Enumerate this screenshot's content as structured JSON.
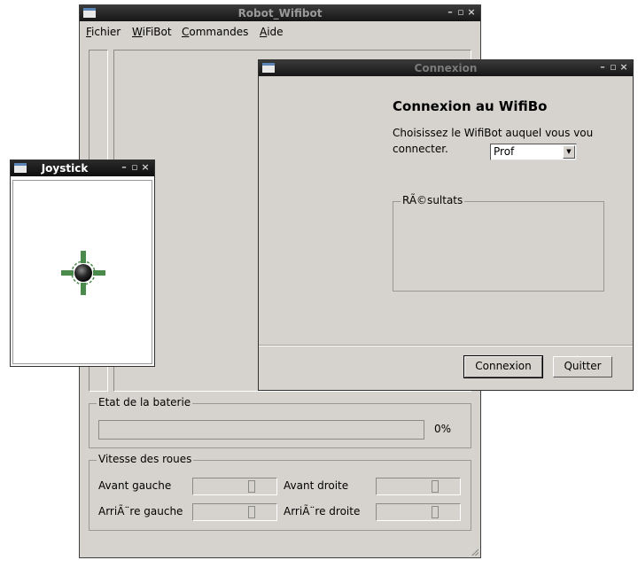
{
  "main_window": {
    "title": "Robot_Wifibot",
    "menu": [
      "Fichier",
      "WiFiBot",
      "Commandes",
      "Aide"
    ],
    "battery": {
      "label": "Etat de la baterie",
      "value_text": "0%",
      "level": 0
    },
    "wheels": {
      "label": "Vitesse des roues",
      "front_left": "Avant gauche",
      "front_right": "Avant droite",
      "rear_left": "ArriÃ¨re gauche",
      "rear_right": "ArriÃ¨re droite"
    }
  },
  "joystick_window": {
    "title": "Joystick",
    "colors": {
      "cross": "#4a8a4a",
      "ball": "#111111"
    }
  },
  "dialog": {
    "title": "Connexion",
    "heading": "Connexion au WifiBo",
    "prompt_line1": "Choisissez le WifiBot auquel vous vou",
    "prompt_line2": "connecter.",
    "robot_select": {
      "selected": "Prof"
    },
    "results_label": "RÃ©sultats",
    "connect_label": "Connexion",
    "quit_label": "Quitter"
  },
  "window_controls": {
    "minimize": "–",
    "maximize": "▫",
    "close": "×"
  }
}
